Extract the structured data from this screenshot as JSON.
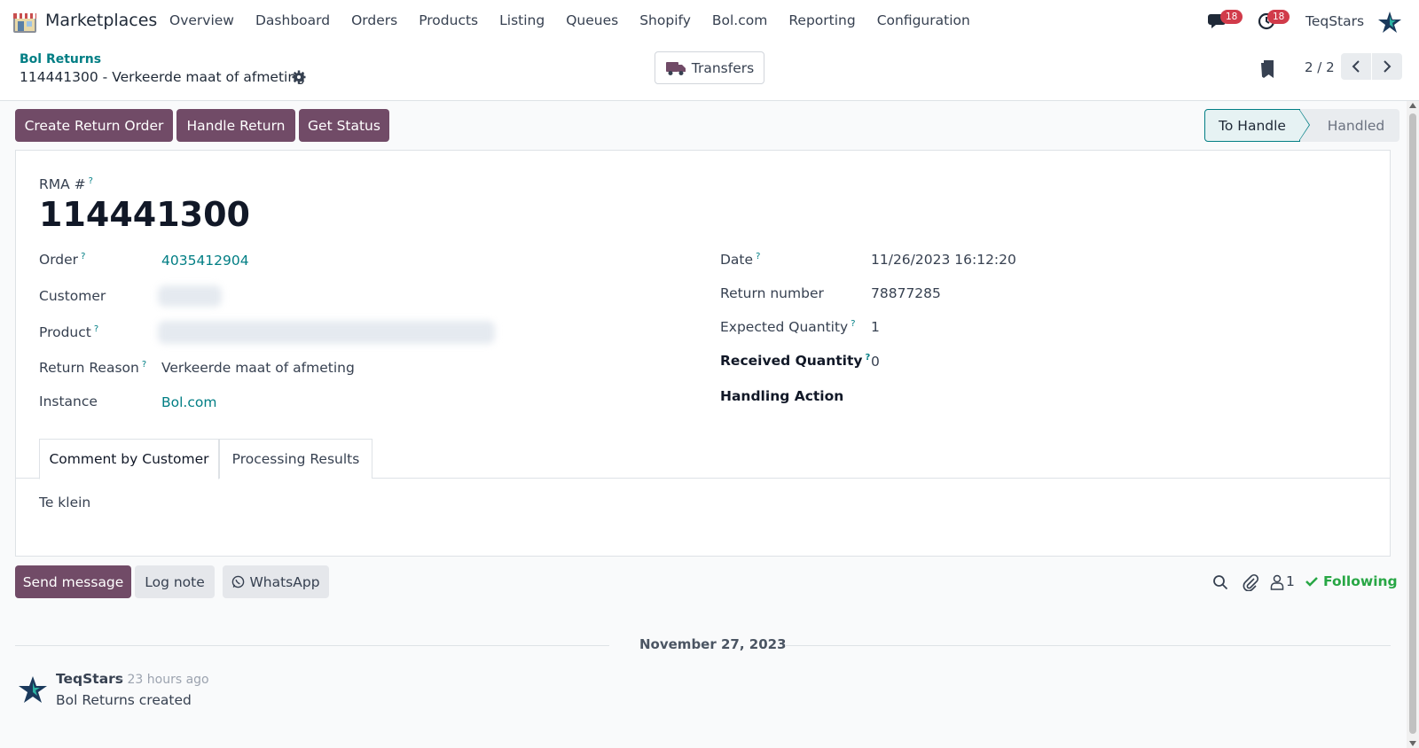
{
  "navbar": {
    "app_name": "Marketplaces",
    "menu": [
      "Overview",
      "Dashboard",
      "Orders",
      "Products",
      "Listing",
      "Queues",
      "Shopify",
      "Bol.com",
      "Reporting",
      "Configuration"
    ],
    "messages_count": "18",
    "activities_count": "18",
    "company": "TeqStars"
  },
  "breadcrumb": {
    "parent": "Bol Returns",
    "current": "114441300 - Verkeerde maat of afmeting"
  },
  "smart_button": {
    "label": "Transfers"
  },
  "pager": {
    "value": "2 / 2"
  },
  "actions": {
    "create_return_order": "Create Return Order",
    "handle_return": "Handle Return",
    "get_status": "Get Status"
  },
  "statusbar": {
    "active": "To Handle",
    "next": "Handled"
  },
  "form": {
    "rma_label": "RMA #",
    "rma_value": "114441300",
    "help_mark": "?",
    "left": {
      "order_label": "Order",
      "order_value": "4035412904",
      "customer_label": "Customer",
      "product_label": "Product",
      "return_reason_label": "Return Reason",
      "return_reason_value": "Verkeerde maat of afmeting",
      "instance_label": "Instance",
      "instance_value": "Bol.com"
    },
    "right": {
      "date_label": "Date",
      "date_value": "11/26/2023 16:12:20",
      "return_number_label": "Return number",
      "return_number_value": "78877285",
      "expected_qty_label": "Expected Quantity",
      "expected_qty_value": "1",
      "received_qty_label": "Received Quantity",
      "received_qty_value": "0",
      "handling_action_label": "Handling Action"
    },
    "tabs": [
      "Comment by Customer",
      "Processing Results"
    ],
    "comment": "Te klein"
  },
  "chatter": {
    "send_message": "Send message",
    "log_note": "Log note",
    "whatsapp": "WhatsApp",
    "followers_count": "1",
    "following": "Following",
    "date_separator": "November 27, 2023",
    "message": {
      "author": "TeqStars",
      "time": "- 23 hours ago",
      "body": "Bol Returns created"
    }
  },
  "colors": {
    "primary": "#714b67",
    "link": "#017e84",
    "badge": "#d13b4a",
    "following": "#28a745"
  }
}
